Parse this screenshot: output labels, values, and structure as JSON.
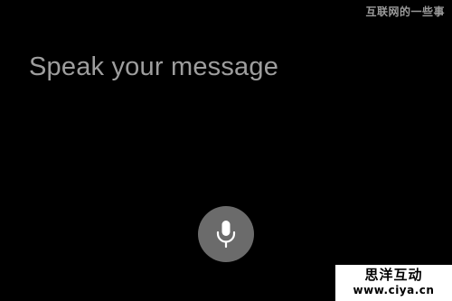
{
  "watermark_top": "互联网的一些事",
  "prompt": {
    "text": "Speak your message"
  },
  "mic_button": {
    "icon": "microphone-icon"
  },
  "watermark_bottom": {
    "brand": "思洋互动",
    "url": "www.ciya.cn"
  },
  "colors": {
    "background": "#000000",
    "prompt_text": "#9e9e9e",
    "mic_button_bg": "#6b6b6b",
    "mic_icon": "#ffffff"
  }
}
